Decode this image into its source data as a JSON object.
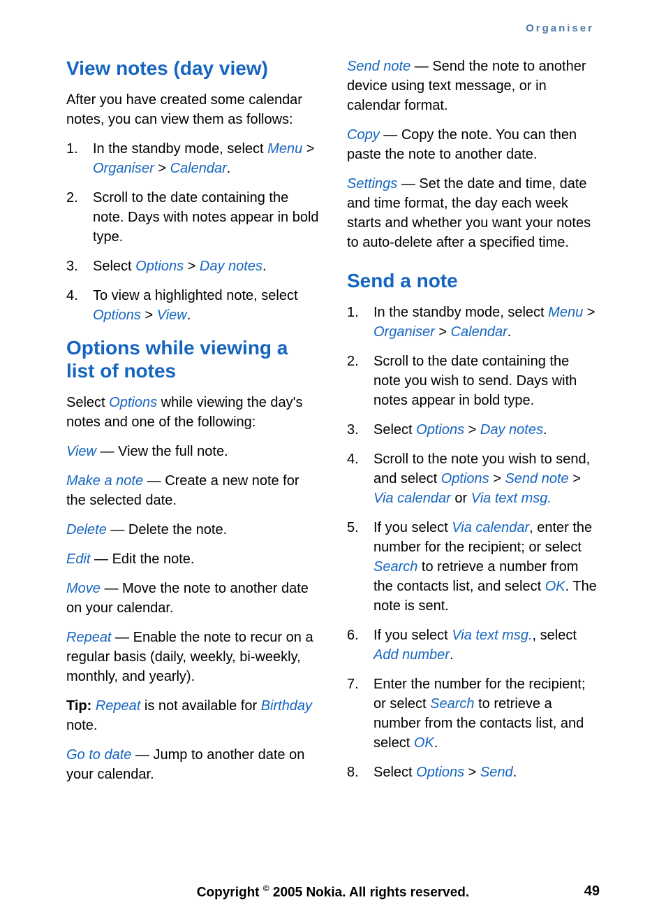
{
  "header": "Organiser",
  "col1": {
    "h1": "View notes (day view)",
    "p1": "After you have created some calendar notes, you can view them as follows:",
    "list1": {
      "i1a": "In the standby mode, select ",
      "i1b": "Menu",
      "i1c": " > ",
      "i1d": "Organiser",
      "i1e": " > ",
      "i1f": "Calendar",
      "i1g": ".",
      "i2": "Scroll to the date containing the note. Days with notes appear in bold type.",
      "i3a": "Select ",
      "i3b": "Options",
      "i3c": " > ",
      "i3d": "Day notes",
      "i3e": ".",
      "i4a": "To view a highlighted note, select ",
      "i4b": "Options",
      "i4c": " > ",
      "i4d": "View",
      "i4e": "."
    },
    "h2": "Options while viewing a list of notes",
    "p2a": "Select ",
    "p2b": "Options",
    "p2c": " while viewing the day's notes and one of the following:",
    "view_t": "View",
    "view_d": " — View the full note.",
    "make_t": "Make a note",
    "make_d": " — Create a new note for the selected date.",
    "del_t": "Delete",
    "del_d": " — Delete the note.",
    "edit_t": "Edit",
    "edit_d": " — Edit the note.",
    "move_t": "Move",
    "move_d": " — Move the note to another date on your calendar.",
    "rep_t": "Repeat",
    "rep_d": " — Enable the note to recur on a regular basis (daily, weekly, bi-weekly, monthly, and yearly).",
    "tip_a": "Tip: ",
    "tip_b": "Repeat",
    "tip_c": " is not available for ",
    "tip_d": "Birthday",
    "tip_e": " note.",
    "goto_t": "Go to date",
    "goto_d": " — Jump to another date on your calendar."
  },
  "col2": {
    "send_t": "Send note",
    "send_d": " — Send the note to another device using text message, or in calendar format.",
    "copy_t": "Copy",
    "copy_d": " — Copy the note. You can then paste the note to another date.",
    "set_t": "Settings",
    "set_d": " — Set the date and time, date and time format, the day each week starts and whether you want your notes to auto-delete after a specified time.",
    "h1": "Send a note",
    "list1": {
      "i1a": "In the standby mode, select ",
      "i1b": "Menu",
      "i1c": " > ",
      "i1d": "Organiser",
      "i1e": " > ",
      "i1f": "Calendar",
      "i1g": ".",
      "i2": "Scroll to the date containing the note you wish to send. Days with notes appear in bold type.",
      "i3a": "Select ",
      "i3b": "Options",
      "i3c": " > ",
      "i3d": "Day notes",
      "i3e": ".",
      "i4a": "Scroll to the note you wish to send, and select ",
      "i4b": "Options",
      "i4c": " > ",
      "i4d": "Send note",
      "i4e": " > ",
      "i4f": "Via calendar",
      "i4g": " or ",
      "i4h": "Via text msg.",
      "i5a": "If you select ",
      "i5b": "Via calendar",
      "i5c": ", enter the number for the recipient; or select ",
      "i5d": "Search",
      "i5e": " to retrieve a number from the contacts list, and select ",
      "i5f": "OK",
      "i5g": ". The note is sent.",
      "i6a": "If you select ",
      "i6b": "Via text msg.",
      "i6c": ", select ",
      "i6d": "Add number",
      "i6e": ".",
      "i7a": "Enter the number for the recipient; or select ",
      "i7b": "Search",
      "i7c": " to retrieve a number from the contacts list, and select ",
      "i7d": "OK",
      "i7e": ".",
      "i8a": "Select ",
      "i8b": "Options",
      "i8c": " > ",
      "i8d": "Send",
      "i8e": "."
    }
  },
  "footer": {
    "copyright_a": "Copyright ",
    "copyright_b": "©",
    "copyright_c": " 2005 Nokia. All rights reserved.",
    "page": "49"
  }
}
